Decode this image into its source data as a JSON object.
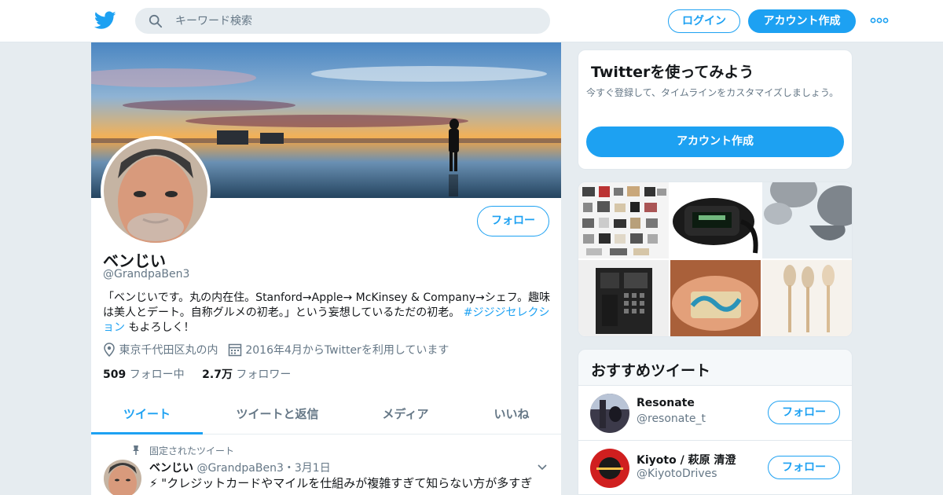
{
  "header": {
    "search_placeholder": "キーワード検索",
    "login_label": "ログイン",
    "signup_label": "アカウント作成",
    "accent": "#1da1f2"
  },
  "profile": {
    "follow_label": "フォロー",
    "name": "ベンじい",
    "handle": "@GrandpaBen3",
    "bio_text": "「ベンじいです。丸の内在住。Stanford→Apple→ McKinsey & Company→シェフ。趣味は美人とデート。自称グルメの初老。」という妄想しているただの初老。",
    "bio_hashtag": "#ジジジセレクション",
    "bio_suffix": " もよろしく！",
    "location": "東京千代田区丸の内",
    "joined": "2016年4月からTwitterを利用しています",
    "following_count": "509",
    "following_label": "フォロー中",
    "followers_count": "2.7万",
    "followers_label": "フォロワー"
  },
  "tabs": [
    {
      "label": "ツイート"
    },
    {
      "label": "ツイートと返信"
    },
    {
      "label": "メディア"
    },
    {
      "label": "いいね"
    }
  ],
  "pinned_tweet": {
    "pinned_label": "固定されたツイート",
    "name": "ベンじい",
    "handle": "@GrandpaBen3",
    "date": "・3月1日",
    "text": "⚡ \"クレジットカードやマイルを仕組みが複雑すぎて知らない方が多すぎ"
  },
  "signup_card": {
    "title": "Twitterを使ってみよう",
    "desc": "今すぐ登録して、タイムラインをカスタマイズしましょう。",
    "cta": "アカウント作成"
  },
  "recommended": {
    "title": "おすすめツイート",
    "accounts": [
      {
        "name": "Resonate",
        "handle": "@resonate_t",
        "follow_label": "フォロー"
      },
      {
        "name": "Kiyoto / 萩原 清澄",
        "handle": "@KiyotoDrives",
        "follow_label": "フォロー"
      }
    ]
  }
}
